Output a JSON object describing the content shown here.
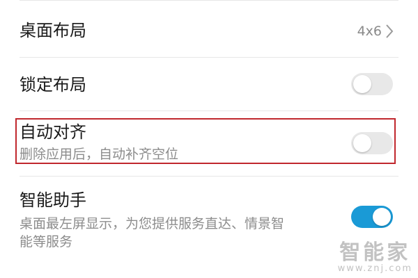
{
  "settings": {
    "desktop_layout": {
      "label": "桌面布局",
      "value": "4x6"
    },
    "lock_layout": {
      "label": "锁定布局",
      "enabled": false
    },
    "auto_align": {
      "label": "自动对齐",
      "description": "删除应用后，自动补齐空位",
      "enabled": false
    },
    "smart_assistant": {
      "label": "智能助手",
      "description_line1": "桌面最左屏显示，为您提供服务直达、情景智",
      "description_line2": "能等服务",
      "enabled": true
    }
  },
  "watermark": {
    "brand": "智能家",
    "url": "www.znj.com"
  },
  "colors": {
    "toggle_on": "#1a9ad6",
    "toggle_off": "#e8e8e8",
    "highlight": "#c0272d"
  },
  "icons": {
    "chevron": "chevron-right-icon"
  }
}
